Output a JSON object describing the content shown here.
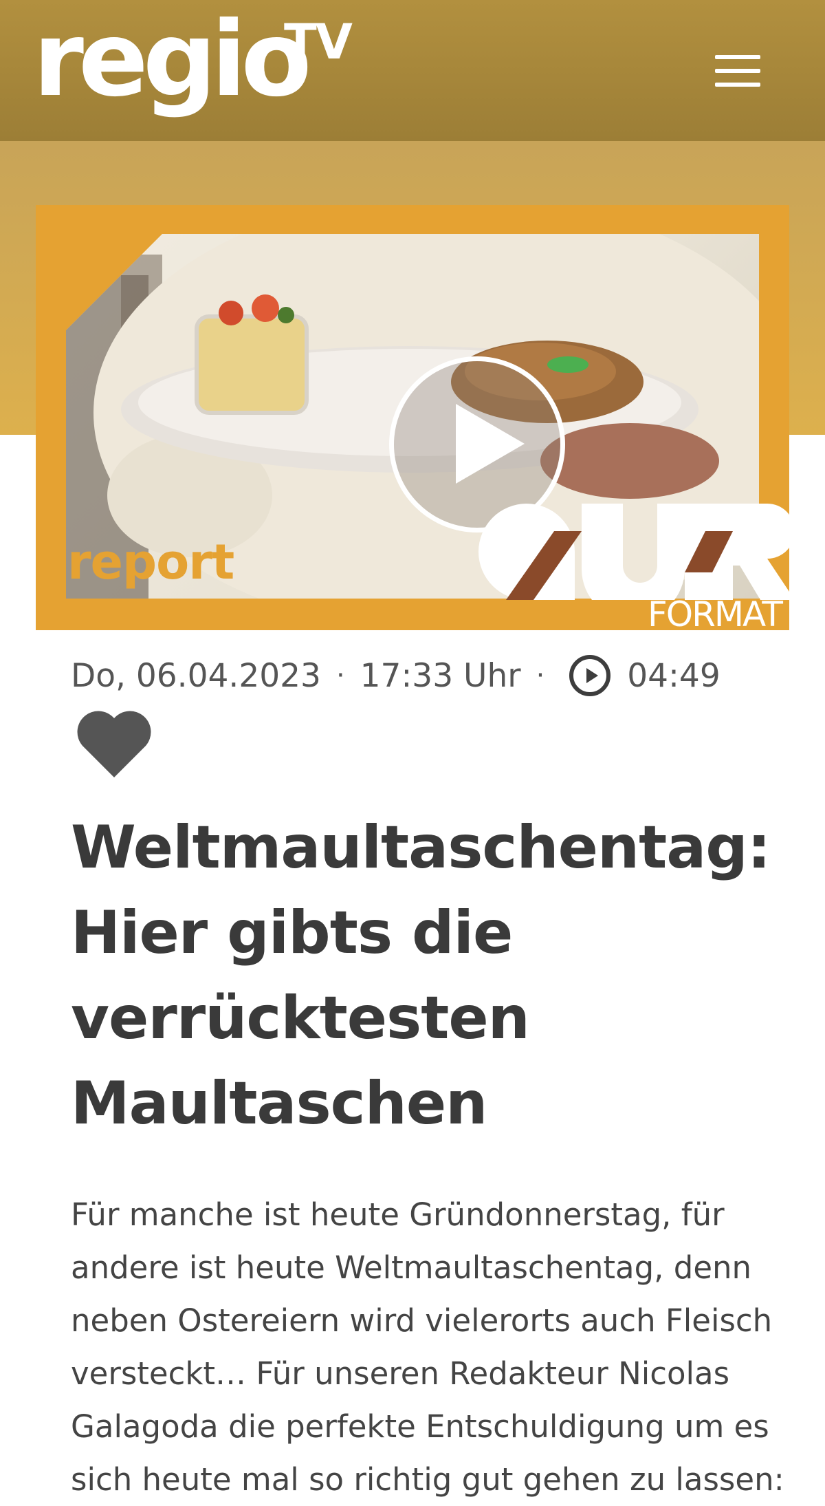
{
  "header": {
    "logo_main": "regio",
    "logo_sup": "TV"
  },
  "video": {
    "overlay_left": "report",
    "overlay_brand": "QUER",
    "overlay_right": "FORMAT",
    "accent_color": "#e5a232"
  },
  "meta": {
    "date": "Do, 06.04.2023",
    "time": "17:33 Uhr",
    "separator": "·",
    "duration": "04:49"
  },
  "article": {
    "title": "Weltmaultaschentag: Hier gibts die verrücktesten Maultaschen",
    "body": "Für manche ist heute Gründonnerstag, für andere ist heute Weltmaultaschentag, denn neben Ostereiern wird vielerorts auch Fleisch versteckt… Für unseren Redakteur Nicolas Galagoda die perfekte Entschuldigung um es sich heute mal so richtig gut gehen zu lassen:"
  },
  "icons": [
    "menu-icon",
    "play-icon",
    "clock-play-icon",
    "heart-icon"
  ]
}
